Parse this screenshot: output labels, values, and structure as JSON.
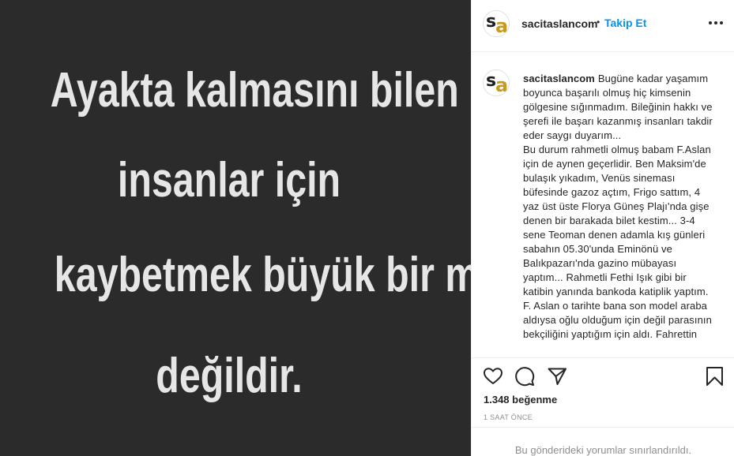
{
  "post_image": {
    "lines": [
      "Ayakta kalmasını bilen",
      "insanlar için",
      "kaybetmek büyük bir mesele",
      "değildir."
    ]
  },
  "header": {
    "avatar_letters": [
      "s",
      "a"
    ],
    "username": "sacitaslancom",
    "separator": "•",
    "follow_label": "Takip Et",
    "more_icon": "more-horizontal-icon"
  },
  "caption": {
    "username": "sacitaslancom",
    "paragraphs": [
      "Bugüne kadar yaşamım boyunca başarılı olmuş hiç kimsenin gölgesine sığınmadım. Bileğinin hakkı ve şerefi ile başarı kazanmış insanları takdir eder saygı duyarım...",
      "Bu durum rahmetli olmuş babam F.Aslan için de aynen geçerlidir. Ben Maksim'de bulaşık yıkadım, Venüs sineması büfesinde gazoz açtım, Frigo sattım, 4 yaz üst üste Florya Güneş Plajı'nda gişe denen bir barakada bilet kestim... 3-4 sene Teoman denen adamla kış günleri sabahın 05.30'unda Eminönü ve Balıkpazarı'nda gazino mübayası yaptım... Rahmetli Fethi Işık gibi bir katibin yanında bankoda katiplik yaptım. F. Aslan o tarihte bana son model araba aldıysa oğlu olduğum için değil parasının bekçiliğini yaptığım için aldı. Fahrettin"
    ]
  },
  "actions": {
    "icons": [
      "heart-icon",
      "comment-icon",
      "share-icon",
      "bookmark-icon"
    ],
    "likes": "1.348 beğenme",
    "timestamp": "1 SAAT ÖNCE"
  },
  "footer": {
    "comments_limited": "Bu gönderideki yorumlar sınırlandırıldı."
  },
  "colors": {
    "image_background": "#2b2b2b",
    "image_text": "#e6e6e6",
    "accent_blue": "#0095f6",
    "avatar_gold": "#c79a1e",
    "text_primary": "#262626",
    "text_secondary": "#8e8e8e"
  }
}
